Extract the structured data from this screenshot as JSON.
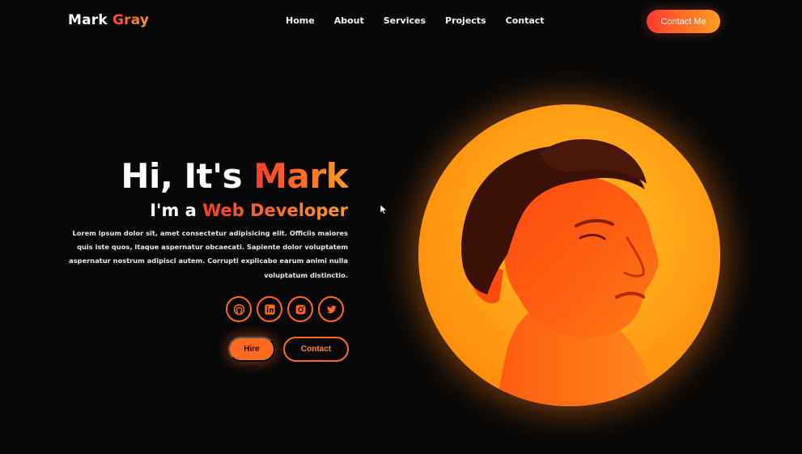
{
  "header": {
    "logo_first": "Mark",
    "logo_second": "Gray",
    "nav": [
      "Home",
      "About",
      "Services",
      "Projects",
      "Contact"
    ],
    "cta": "Contact Me"
  },
  "hero": {
    "greeting": "Hi, It's",
    "name": "Mark",
    "subtitle_prefix": "I'm a",
    "role": "Web Developer",
    "description": "Lorem ipsum dolor sit, amet consectetur adipisicing elit. Officiis maiores quis iste quos, itaque aspernatur obcaecati. Sapiente dolor voluptatem aspernatur nostrum adipisci autem. Corrupti explicabo earum animi nulla voluptatum distinctio.",
    "buttons": {
      "primary": "Hire",
      "secondary": "Contact"
    }
  },
  "socials": [
    {
      "icon": "github-icon"
    },
    {
      "icon": "linkedin-icon"
    },
    {
      "icon": "instagram-icon"
    },
    {
      "icon": "twitter-icon"
    }
  ],
  "colors": {
    "background": "#080808",
    "accent_start": "#ff3b2f",
    "accent_end": "#ff9e22",
    "accent": "#ff6a1e"
  }
}
